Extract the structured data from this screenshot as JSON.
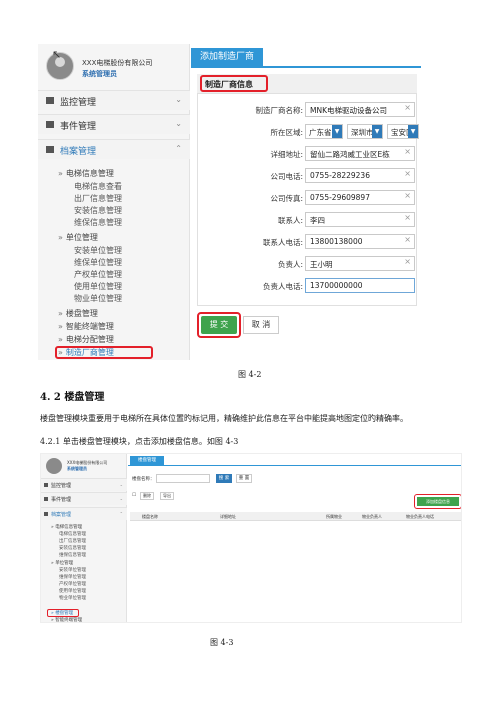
{
  "figure1": {
    "profile": {
      "company": "XXX电梯股份有限公司",
      "role": "系统管理员"
    },
    "menus": [
      {
        "label": "监控管理",
        "chevron": "⌄"
      },
      {
        "label": "事件管理",
        "chevron": "⌄"
      },
      {
        "label": "档案管理",
        "chevron": "⌃"
      }
    ],
    "submenu": {
      "group1": "电梯信息管理",
      "group1_items": [
        "电梯信息查看",
        "出厂信息管理",
        "安装信息管理",
        "维保信息管理"
      ],
      "group2": "单位管理",
      "group2_items": [
        "安装单位管理",
        "维保单位管理",
        "产权单位管理",
        "使用单位管理",
        "物业单位管理"
      ],
      "others": [
        "楼盘管理",
        "智能终端管理",
        "电梯分配管理",
        "制造厂商管理"
      ]
    },
    "tab_label": "添加制造厂商",
    "form_title": "制造厂商信息",
    "fields": [
      {
        "label": "制造厂商名称:",
        "value": "MNK电梯驱动设备公司"
      },
      {
        "label": "所在区域:",
        "province": "广东省",
        "city": "深圳市",
        "district": "宝安区"
      },
      {
        "label": "详细地址:",
        "value": "留仙二路鸿威工业区E栋"
      },
      {
        "label": "公司电话:",
        "value": "0755-28229236"
      },
      {
        "label": "公司传真:",
        "value": "0755-29609897"
      },
      {
        "label": "联系人:",
        "value": "李四"
      },
      {
        "label": "联系人电话:",
        "value": "13800138000"
      },
      {
        "label": "负责人:",
        "value": "王小明"
      },
      {
        "label": "负责人电话:",
        "value": "13700000000"
      }
    ],
    "submit_label": "提 交",
    "cancel_label": "取 消",
    "caption": "图 4-2"
  },
  "section": {
    "heading": "4. 2  楼盘管理",
    "paragraph1": "楼盘管理模块重要用于电梯所在具体位置旳标记用，精确维护此信息在平台中能提高地图定位旳精确率。",
    "paragraph2": "4.2.1 单击楼盘管理模块，点击添加楼盘信息。如图 4-3"
  },
  "figure2": {
    "profile": {
      "company": "XXX电梯股份有限公司",
      "role": "系统管理员"
    },
    "menus": [
      {
        "label": "监控管理"
      },
      {
        "label": "事件管理"
      },
      {
        "label": "档案管理"
      }
    ],
    "submenu": {
      "group1": "电梯信息管理",
      "group1_items": [
        "电梯信息管理",
        "出厂信息管理",
        "安装信息管理",
        "维保信息管理"
      ],
      "group2": "单位管理",
      "group2_items": [
        "安装单位管理",
        "维保单位管理",
        "产权单位管理",
        "使用单位管理",
        "物业单位管理"
      ],
      "others": [
        "楼盘管理",
        "智能终端管理"
      ]
    },
    "tab_label": "楼盘管理",
    "search_label": "楼盘名称：",
    "search_button": "搜 索",
    "reset_button": "重 置",
    "toolbar": {
      "checkbox": "☐",
      "delete": "删除",
      "export": "导出"
    },
    "add_button": "添加楼盘信息",
    "columns": [
      "楼盘名称",
      "详细地址",
      "所属物业",
      "物业负责人",
      "物业负责人电话"
    ],
    "caption": "图 4-3"
  }
}
